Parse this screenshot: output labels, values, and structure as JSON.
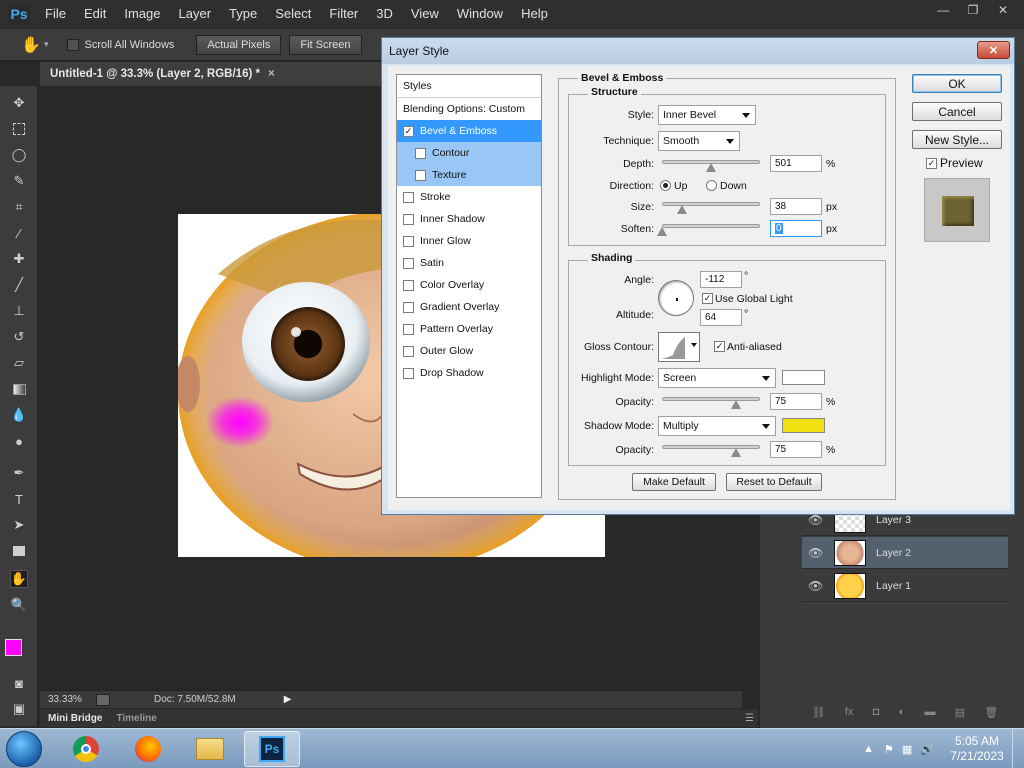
{
  "app": {
    "logo": "Ps",
    "menu": [
      "File",
      "Edit",
      "Image",
      "Layer",
      "Type",
      "Select",
      "Filter",
      "3D",
      "View",
      "Window",
      "Help"
    ],
    "window_controls": {
      "minimize": "—",
      "restore": "❐",
      "close": "✕"
    }
  },
  "options_bar": {
    "scroll_all_windows": "Scroll All Windows",
    "actual_pixels": "Actual Pixels",
    "fit_screen": "Fit Screen"
  },
  "document": {
    "tab_title": "Untitled-1 @ 33.3% (Layer 2, RGB/16) *",
    "tab_close": "×"
  },
  "status": {
    "zoom": "33.33%",
    "doc_size": "Doc: 7.50M/52.8M"
  },
  "bottom_tabs": [
    "Mini Bridge",
    "Timeline"
  ],
  "layers": [
    {
      "name": "Layer 3"
    },
    {
      "name": "Layer 2",
      "selected": true
    },
    {
      "name": "Layer 1"
    }
  ],
  "colors": {
    "foreground": "#ff00ff",
    "background": "#ffffff",
    "shadow_swatch": "#f0e010",
    "highlight_swatch": "#ffffff",
    "selection_blue": "#3399ff"
  },
  "dialog": {
    "title": "Layer Style",
    "close": "✕",
    "styles_header": "Styles",
    "blending_options": "Blending Options: Custom",
    "styles": [
      {
        "label": "Bevel & Emboss",
        "checked": true,
        "selected": true
      },
      {
        "label": "Contour",
        "checked": false,
        "sub": true
      },
      {
        "label": "Texture",
        "checked": false,
        "sub": true
      },
      {
        "label": "Stroke",
        "checked": false
      },
      {
        "label": "Inner Shadow",
        "checked": false
      },
      {
        "label": "Inner Glow",
        "checked": false
      },
      {
        "label": "Satin",
        "checked": false
      },
      {
        "label": "Color Overlay",
        "checked": false
      },
      {
        "label": "Gradient Overlay",
        "checked": false
      },
      {
        "label": "Pattern Overlay",
        "checked": false
      },
      {
        "label": "Outer Glow",
        "checked": false
      },
      {
        "label": "Drop Shadow",
        "checked": false
      }
    ],
    "bevel": {
      "section_title": "Bevel & Emboss",
      "structure_title": "Structure",
      "style_label": "Style:",
      "style_value": "Inner Bevel",
      "technique_label": "Technique:",
      "technique_value": "Smooth",
      "depth_label": "Depth:",
      "depth_value": "501",
      "depth_unit": "%",
      "depth_level": 0.5,
      "direction_label": "Direction:",
      "direction_up": "Up",
      "direction_down": "Down",
      "size_label": "Size:",
      "size_value": "38",
      "size_unit": "px",
      "size_level": 0.2,
      "soften_label": "Soften:",
      "soften_value": "0",
      "soften_unit": "px",
      "soften_level": 0.0
    },
    "shading": {
      "title": "Shading",
      "angle_label": "Angle:",
      "angle_value": "-112",
      "angle_unit": "°",
      "use_global_light": "Use Global Light",
      "altitude_label": "Altitude:",
      "altitude_value": "64",
      "altitude_unit": "°",
      "gloss_label": "Gloss Contour:",
      "anti_aliased": "Anti-aliased",
      "highlight_mode_label": "Highlight Mode:",
      "highlight_mode_value": "Screen",
      "opacity_label": "Opacity:",
      "highlight_opacity": "75",
      "highlight_opacity_level": 0.75,
      "shadow_mode_label": "Shadow Mode:",
      "shadow_mode_value": "Multiply",
      "shadow_opacity": "75",
      "shadow_opacity_level": 0.75,
      "percent": "%"
    },
    "make_default": "Make Default",
    "reset_default": "Reset to Default",
    "ok": "OK",
    "cancel": "Cancel",
    "new_style": "New Style...",
    "preview": "Preview"
  },
  "taskbar": {
    "time": "5:05 AM",
    "date": "7/21/2023",
    "apps": [
      "chrome",
      "firefox",
      "file-explorer",
      "photoshop"
    ]
  }
}
